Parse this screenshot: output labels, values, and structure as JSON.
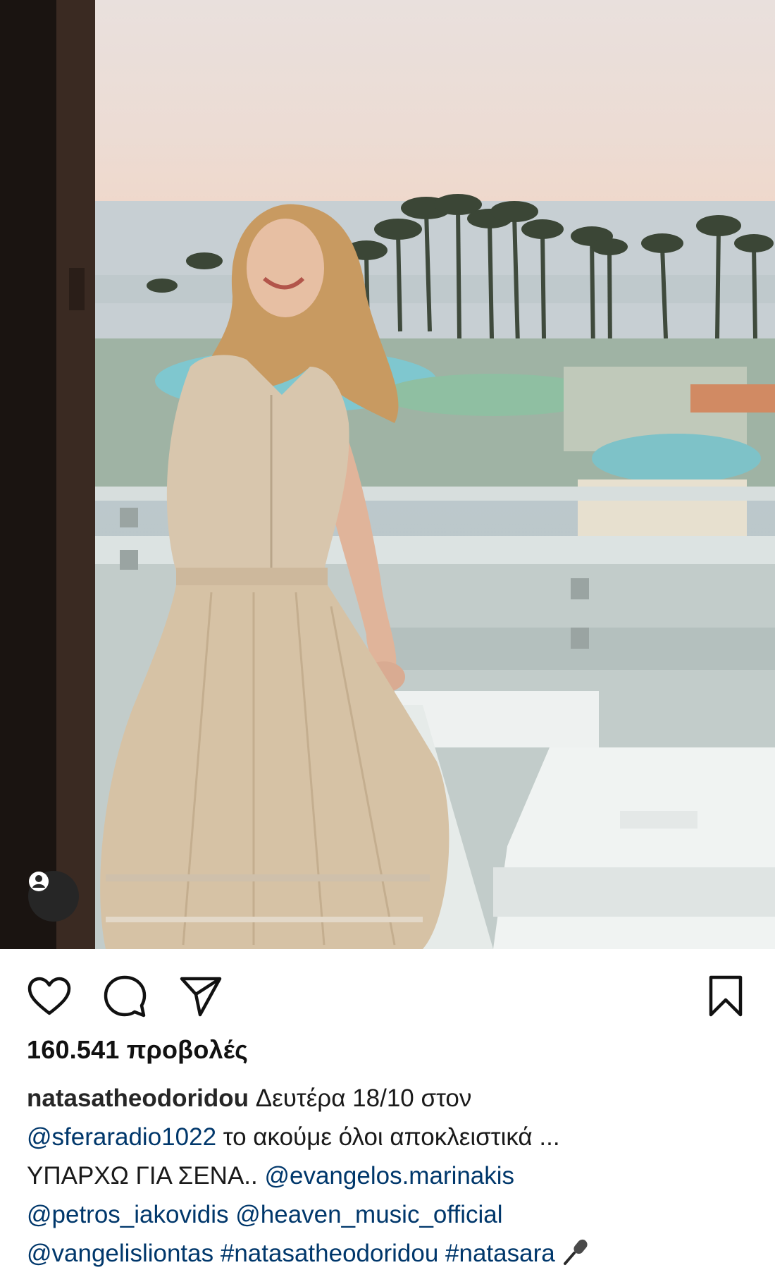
{
  "media": {
    "type": "video",
    "tag_icon": "user-tag-icon"
  },
  "actions": {
    "like_icon": "heart-icon",
    "comment_icon": "comment-icon",
    "share_icon": "paper-plane-icon",
    "save_icon": "bookmark-icon"
  },
  "stats": {
    "views": "160.541 προβολές"
  },
  "caption": {
    "username": "natasatheodoridou",
    "line1_text": " Δευτέρα 18/10 στον",
    "mention_sfera": "@sferaradio1022",
    "line2_text": " το ακούμε όλοι αποκλειστικά ...",
    "line3_text": "ΥΠΑΡΧΩ ΓΙΑ ΣΕΝΑ.. ",
    "mention_evangelos": "@evangelos.marinakis",
    "mention_petros": "@petros_iakovidis",
    "mention_heaven": "@heaven_music_official",
    "mention_vangelis": "@vangelisliontas",
    "hashtag_natasa": "#natasatheodoridou",
    "hashtag_natasara": "#natasara",
    "emoji": "microphone-icon"
  },
  "colors": {
    "link": "#00376b",
    "text": "#1a1a1a"
  }
}
